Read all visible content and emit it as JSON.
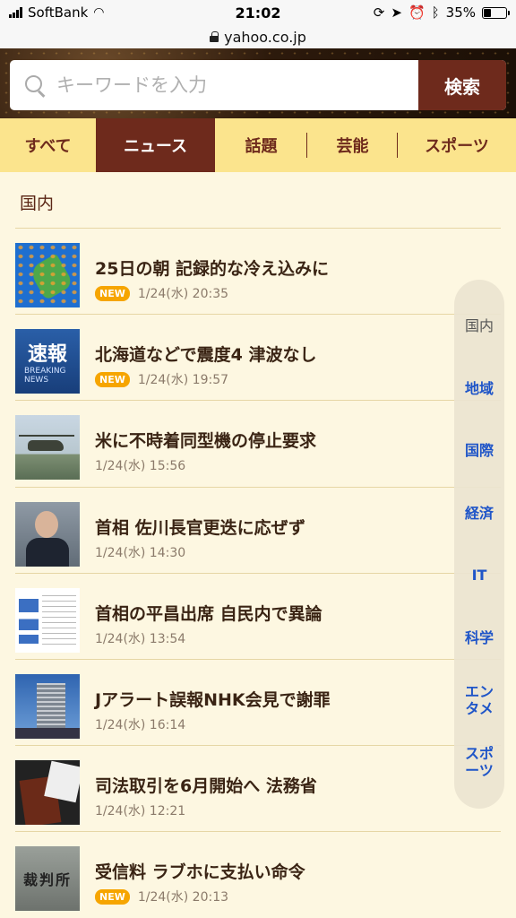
{
  "status": {
    "carrier": "SoftBank",
    "time": "21:02",
    "battery": "35%",
    "battery_level": 0.35
  },
  "url": "yahoo.co.jp",
  "search": {
    "placeholder": "キーワードを入力",
    "button": "検索"
  },
  "tabs": [
    {
      "label": "すべて",
      "active": false
    },
    {
      "label": "ニュース",
      "active": true
    },
    {
      "label": "話題",
      "active": false
    },
    {
      "label": "芸能",
      "active": false
    },
    {
      "label": "スポーツ",
      "active": false
    }
  ],
  "section": {
    "title": "国内"
  },
  "news": [
    {
      "title": "25日の朝 記録的な冷え込みに",
      "date": "1/24(水) 20:35",
      "new": "NEW"
    },
    {
      "title": "北海道などで震度4 津波なし",
      "date": "1/24(水) 19:57",
      "new": "NEW"
    },
    {
      "title": "米に不時着同型機の停止要求",
      "date": "1/24(水) 15:56",
      "new": ""
    },
    {
      "title": "首相 佐川長官更迭に応ぜず",
      "date": "1/24(水) 14:30",
      "new": ""
    },
    {
      "title": "首相の平昌出席 自民内で異論",
      "date": "1/24(水) 13:54",
      "new": ""
    },
    {
      "title": "Jアラート誤報NHK会見で謝罪",
      "date": "1/24(水) 16:14",
      "new": ""
    },
    {
      "title": "司法取引を6月開始へ 法務省",
      "date": "1/24(水) 12:21",
      "new": ""
    },
    {
      "title": "受信料 ラブホに支払い命令",
      "date": "1/24(水) 20:13",
      "new": "NEW"
    }
  ],
  "thumb_text": {
    "breaking_big": "速報",
    "breaking_small1": "BREAKING",
    "breaking_small2": "NEWS",
    "court": "裁判所"
  },
  "side_index": [
    {
      "line1": "国内",
      "line2": "",
      "current": true
    },
    {
      "line1": "地域",
      "line2": "",
      "current": false
    },
    {
      "line1": "国際",
      "line2": "",
      "current": false
    },
    {
      "line1": "経済",
      "line2": "",
      "current": false
    },
    {
      "line1": "IT",
      "line2": "",
      "current": false
    },
    {
      "line1": "科学",
      "line2": "",
      "current": false
    },
    {
      "line1": "エン",
      "line2": "タメ",
      "current": false
    },
    {
      "line1": "スポ",
      "line2": "ーツ",
      "current": false
    }
  ]
}
